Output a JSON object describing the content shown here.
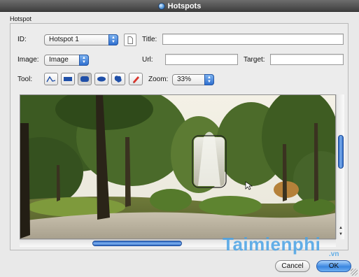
{
  "window": {
    "title": "Hotspots"
  },
  "section": {
    "label": "Hotspot"
  },
  "form": {
    "id_label": "ID:",
    "id_value": "Hotspot 1",
    "title_label": "Title:",
    "title_value": "",
    "image_label": "Image:",
    "image_value": "Image",
    "url_label": "Url:",
    "url_value": "",
    "target_label": "Target:",
    "target_value": "",
    "tool_label": "Tool:",
    "zoom_label": "Zoom:",
    "zoom_value": "33%"
  },
  "tools": [
    {
      "name": "polyline-tool",
      "icon": "polyline-icon"
    },
    {
      "name": "rectangle-tool",
      "icon": "rectangle-icon"
    },
    {
      "name": "rounded-rectangle-tool",
      "icon": "rounded-rectangle-icon",
      "active": true
    },
    {
      "name": "ellipse-tool",
      "icon": "ellipse-icon"
    },
    {
      "name": "freeform-tool",
      "icon": "freeform-icon"
    },
    {
      "name": "eraser-tool",
      "icon": "eraser-icon"
    }
  ],
  "image_view": {
    "vertical_scroll_position": 0.3,
    "horizontal_scroll_position": 0.3
  },
  "buttons": {
    "cancel_label": "Cancel",
    "ok_label": "OK"
  },
  "watermark": {
    "text": "Taimienphi",
    "sub": ".vn"
  },
  "colors": {
    "accent": "#3a86e0",
    "titlebar": "#4f4f4f"
  }
}
